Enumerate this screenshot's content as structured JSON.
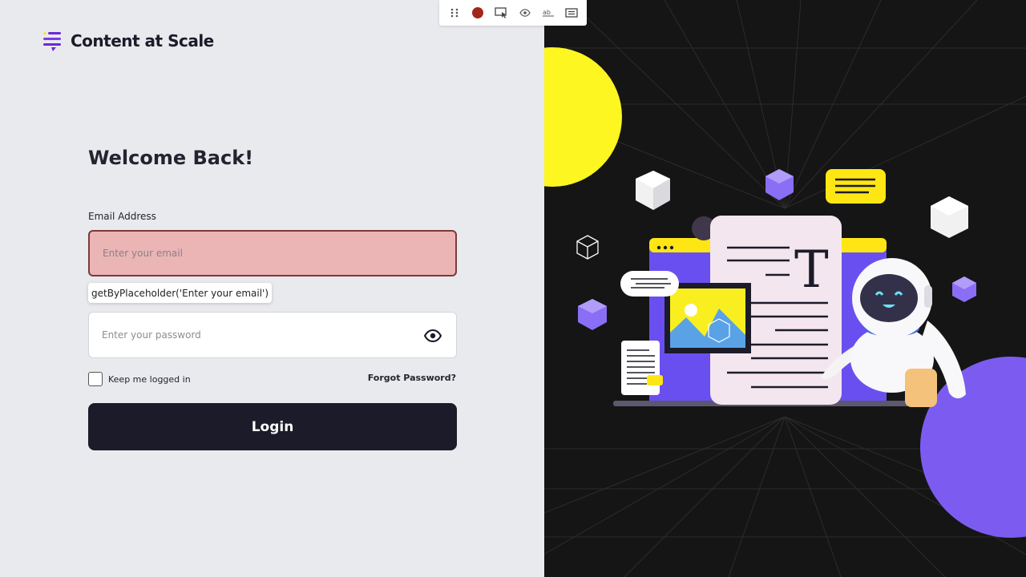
{
  "brand": {
    "name": "Content at Scale"
  },
  "login": {
    "title": "Welcome Back!",
    "email_label": "Email Address",
    "email_placeholder": "Enter your email",
    "password_placeholder": "Enter your password",
    "remember_label": "Keep me logged in",
    "forgot_label": "Forgot Password?",
    "login_label": "Login"
  },
  "tooltip": {
    "text": "getByPlaceholder('Enter your email')"
  },
  "toolbar": {
    "icons": [
      "drag-handle-icon",
      "record-icon",
      "pick-locator-icon",
      "assert-visibility-icon",
      "assert-text-icon",
      "assert-value-icon"
    ]
  },
  "colors": {
    "accent": "#7b5cf0",
    "dark": "#1c1b29",
    "yellow": "#fef521",
    "error_bg": "#ebb5b5"
  }
}
